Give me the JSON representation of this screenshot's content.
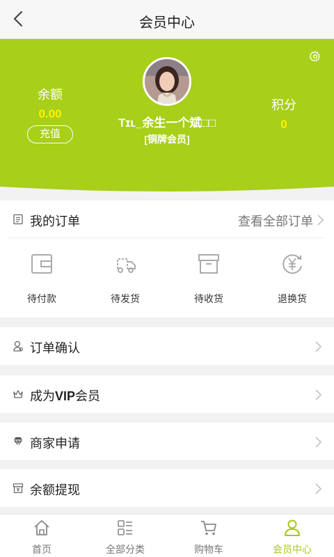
{
  "topbar": {
    "title": "会员中心",
    "back_icon": "chevron-left-icon"
  },
  "colors": {
    "accent": "#a8cf1a",
    "value": "#fff200",
    "active_tab": "#a3c91a"
  },
  "profile": {
    "balance_label": "余额",
    "balance_value": "0.00",
    "recharge_label": "充值",
    "username": "Tɪʟ_余生一个斌□□",
    "level": "[铜牌会员]",
    "points_label": "积分",
    "points_value": "0",
    "settings_icon": "gear-icon"
  },
  "orders": {
    "title": "我的订单",
    "view_all": "查看全部订单",
    "statuses": [
      {
        "label": "待付款",
        "icon": "wallet-icon"
      },
      {
        "label": "待发货",
        "icon": "truck-icon"
      },
      {
        "label": "待收货",
        "icon": "box-icon"
      },
      {
        "label": "退换货",
        "icon": "yen-return-icon"
      }
    ]
  },
  "menu": [
    {
      "label": "订单确认",
      "icon": "person-icon"
    },
    {
      "label_prefix": "成为",
      "label_bold": "VIP",
      "label_suffix": "会员",
      "icon": "crown-icon"
    },
    {
      "label": "商家申请",
      "icon": "diamond-icon"
    },
    {
      "label": "余额提现",
      "icon": "cash-box-icon"
    }
  ],
  "tabbar": [
    {
      "label": "首页",
      "icon": "home-icon",
      "active": false
    },
    {
      "label": "全部分类",
      "icon": "category-icon",
      "active": false
    },
    {
      "label": "购物车",
      "icon": "cart-icon",
      "active": false
    },
    {
      "label": "会员中心",
      "icon": "user-icon",
      "active": true
    }
  ]
}
